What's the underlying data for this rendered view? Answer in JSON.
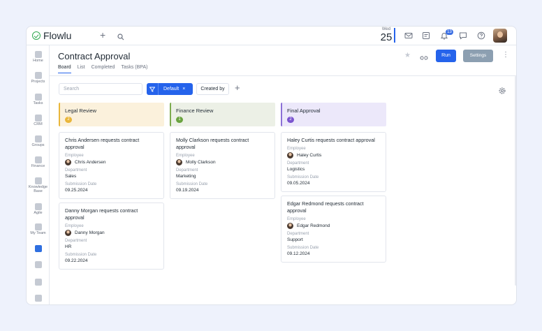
{
  "app": {
    "name": "Flowlu"
  },
  "topbar": {
    "date_day": "Wed",
    "date_num": "25",
    "notifications_count": "13"
  },
  "sidebar": {
    "items": [
      {
        "label": "Home",
        "icon": "home-icon"
      },
      {
        "label": "Projects",
        "icon": "projects-icon"
      },
      {
        "label": "Tasks",
        "icon": "tasks-icon"
      },
      {
        "label": "CRM",
        "icon": "crm-icon"
      },
      {
        "label": "Groups",
        "icon": "groups-icon"
      },
      {
        "label": "Finance",
        "icon": "finance-icon"
      },
      {
        "label": "Knowledge Base",
        "icon": "knowledge-base-icon"
      },
      {
        "label": "Agile",
        "icon": "agile-icon"
      },
      {
        "label": "My Team",
        "icon": "my-team-icon"
      }
    ]
  },
  "header": {
    "title": "Contract Approval",
    "tabs": [
      "Board",
      "List",
      "Completed",
      "Tasks (BPA)"
    ],
    "active_tab": "Board",
    "run_label": "Run",
    "settings_label": "Settings"
  },
  "filters": {
    "search_placeholder": "Search",
    "filter_label": "Default",
    "filter_clear": "×",
    "created_by_label": "Created by",
    "add_label": "+"
  },
  "columns": [
    {
      "title": "Legal Review",
      "count": "2",
      "bg": "#fbf1dc",
      "border": "#e9b63a",
      "badge": "#e9b63a",
      "cards": [
        {
          "title": "Chris Andersen requests contract approval",
          "employee": "Chris Andersen",
          "department": "Sales",
          "date": "09.25.2024"
        },
        {
          "title": "Danny Morgan requests contract approval",
          "employee": "Danny Morgan",
          "department": "HR",
          "date": "09.22.2024"
        }
      ]
    },
    {
      "title": "Finance Review",
      "count": "1",
      "bg": "#ecf0e6",
      "border": "#7cab4e",
      "badge": "#6aa33f",
      "cards": [
        {
          "title": "Molly Clarkson requests contract approval",
          "employee": "Molly Clarkson",
          "department": "Marketing",
          "date": "09.19.2024"
        }
      ]
    },
    {
      "title": "Final Approval",
      "count": "2",
      "bg": "#ece8fa",
      "border": "#8b6fd6",
      "badge": "#7b55cf",
      "cards": [
        {
          "title": "Haley Curtis requests contract approval",
          "employee": "Haley Curtis",
          "department": "Logistics",
          "date": "09.05.2024"
        },
        {
          "title": "Edgar Redmond requests contract approval",
          "employee": "Edgar Redmond",
          "department": "Support",
          "date": "09.12.2024"
        }
      ]
    }
  ],
  "field_labels": {
    "employee": "Employee",
    "department": "Department",
    "date": "Submission Date"
  }
}
